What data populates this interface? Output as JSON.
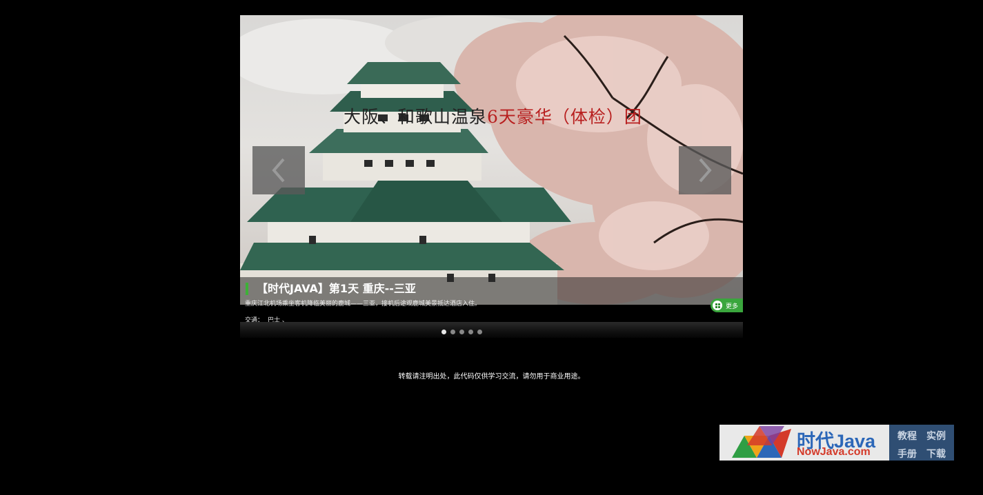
{
  "slider": {
    "banner_text_dark": "大阪、和歌山温泉",
    "banner_text_red": "6天豪华（体检）团",
    "prev_label": "‹",
    "next_label": "›",
    "caption": {
      "title": "【时代JAVA】第1天 重庆--三亚",
      "description": "重庆江北机场乘坐客机降临美丽的鹿城——三亚，接机后途观鹿城美景抵达酒店入住。",
      "traffic_label": "交通：",
      "traffic_value": "巴士 、"
    },
    "more_label": "更多",
    "page_count": 5,
    "active_page": 1
  },
  "notice": "转载请注明出处，此代码仅供学习交流，请勿用于商业用途。",
  "logo": {
    "name_cn": "时代Java",
    "name_en": "NowJava.com",
    "links": [
      "教程",
      "实例",
      "手册",
      "下载"
    ]
  },
  "colors": {
    "background": "#000000",
    "accent_green": "#3aa63d",
    "banner_red": "#b81f1f",
    "logo_blue": "#2c67b8",
    "logo_red": "#d43a2a"
  }
}
